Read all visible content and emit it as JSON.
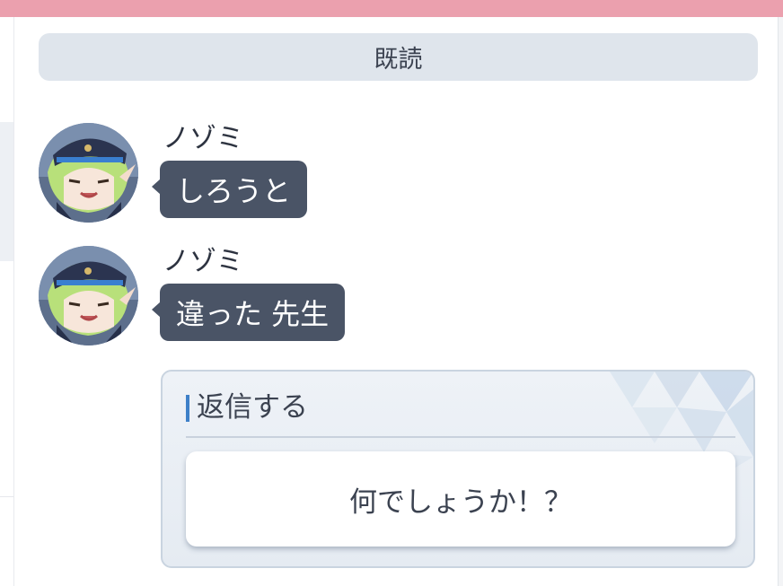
{
  "header": {
    "read_status": "既読"
  },
  "messages": [
    {
      "sender": "ノゾミ",
      "text": "しろうと",
      "avatar_icon": "nozomi-avatar"
    },
    {
      "sender": "ノゾミ",
      "text": "違った 先生",
      "avatar_icon": "nozomi-avatar"
    }
  ],
  "reply": {
    "title": "返信する",
    "options": [
      "何でしょうか！？"
    ]
  },
  "colors": {
    "top_bar": "#eba0ae",
    "bubble": "#4a5466",
    "banner": "#dfe5ec",
    "accent": "#3e80c8"
  }
}
